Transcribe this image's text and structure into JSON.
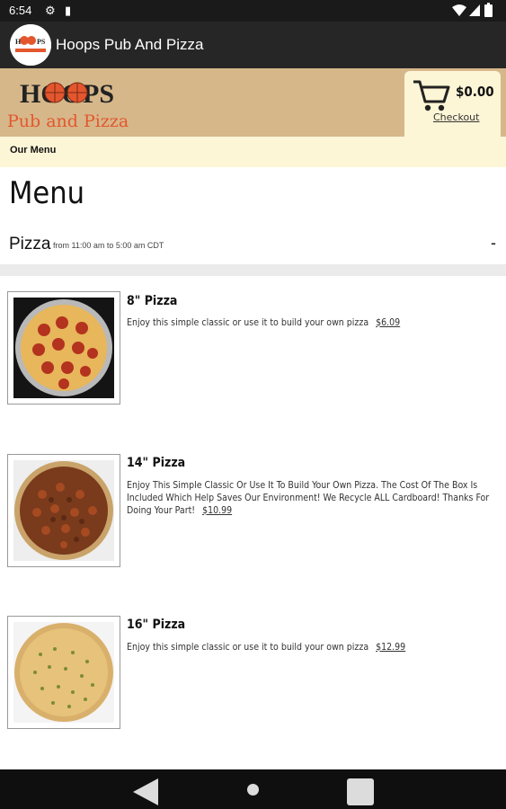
{
  "status_bar": {
    "time": "6:54"
  },
  "app_bar": {
    "title": "Hoops Pub And Pizza"
  },
  "brand": {
    "line1": "HOOPS",
    "line2": "Pub and Pizza"
  },
  "cart": {
    "amount": "$0.00",
    "checkout_label": "Checkout"
  },
  "subnav": {
    "label": "Our Menu"
  },
  "menu": {
    "title": "Menu",
    "category": {
      "name": "Pizza",
      "hours": "from 11:00 am to 5:00 am CDT",
      "toggle": "-"
    },
    "items": [
      {
        "name": "8\" Pizza",
        "description": "Enjoy this simple classic or use it to build your own pizza",
        "price": "$6.09"
      },
      {
        "name": "14\" Pizza",
        "description": "Enjoy This Simple Classic Or Use It To Build Your Own Pizza. The Cost Of The Box Is Included Which Help Saves Our Environment! We Recycle ALL Cardboard! Thanks For Doing Your Part!",
        "price": "$10.99"
      },
      {
        "name": "16\" Pizza",
        "description": "Enjoy this simple classic or use it to build your own pizza",
        "price": "$12.99"
      }
    ]
  },
  "colors": {
    "banner": "#d6b78a",
    "cream": "#fdf6d6",
    "appbar": "#262626",
    "brand_orange": "#e4572e"
  }
}
